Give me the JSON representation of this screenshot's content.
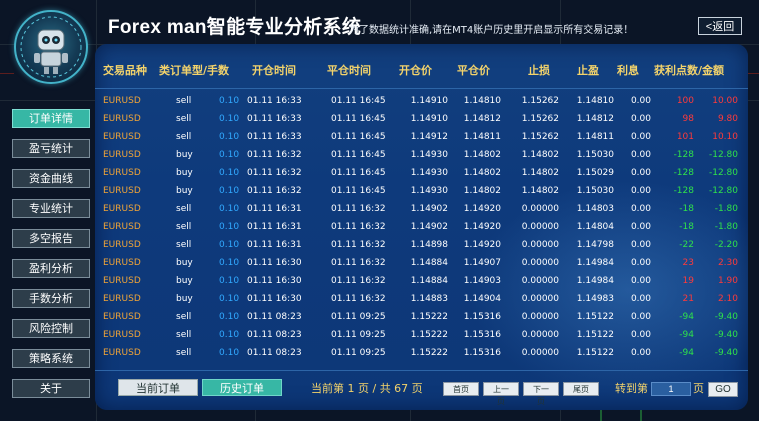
{
  "header": {
    "title": "Forex man智能专业分析系统",
    "subtitle": "为了数据统计准确,请在MT4账户历史里开启显示所有交易记录！",
    "back_label": "<返回"
  },
  "sidebar": {
    "items": [
      {
        "label": "订单详情",
        "active": true
      },
      {
        "label": "盈亏统计",
        "active": false
      },
      {
        "label": "资金曲线",
        "active": false
      },
      {
        "label": "专业统计",
        "active": false
      },
      {
        "label": "多空报告",
        "active": false
      },
      {
        "label": "盈利分析",
        "active": false
      },
      {
        "label": "手数分析",
        "active": false
      },
      {
        "label": "风险控制",
        "active": false
      },
      {
        "label": "策略系统",
        "active": false
      },
      {
        "label": "关于",
        "active": false
      }
    ]
  },
  "table": {
    "columns": [
      "交易品种",
      "类订单型/手数",
      "开仓时间",
      "平仓时间",
      "开仓价",
      "平仓价",
      "止损",
      "止盈",
      "利息",
      "获利点数/金额"
    ],
    "rows": [
      {
        "symbol": "EURUSD",
        "type": "sell",
        "lots": "0.10",
        "open_time": "01.11 16:33",
        "close_time": "01.11 16:45",
        "open_price": "1.14910",
        "close_price": "1.14810",
        "sl": "1.15262",
        "tp": "1.14810",
        "swap": "0.00",
        "points": "100",
        "amount": "10.00",
        "positive": true
      },
      {
        "symbol": "EURUSD",
        "type": "sell",
        "lots": "0.10",
        "open_time": "01.11 16:33",
        "close_time": "01.11 16:45",
        "open_price": "1.14910",
        "close_price": "1.14812",
        "sl": "1.15262",
        "tp": "1.14812",
        "swap": "0.00",
        "points": "98",
        "amount": "9.80",
        "positive": true
      },
      {
        "symbol": "EURUSD",
        "type": "sell",
        "lots": "0.10",
        "open_time": "01.11 16:33",
        "close_time": "01.11 16:45",
        "open_price": "1.14912",
        "close_price": "1.14811",
        "sl": "1.15262",
        "tp": "1.14811",
        "swap": "0.00",
        "points": "101",
        "amount": "10.10",
        "positive": true
      },
      {
        "symbol": "EURUSD",
        "type": "buy",
        "lots": "0.10",
        "open_time": "01.11 16:32",
        "close_time": "01.11 16:45",
        "open_price": "1.14930",
        "close_price": "1.14802",
        "sl": "1.14802",
        "tp": "1.15030",
        "swap": "0.00",
        "points": "-128",
        "amount": "-12.80",
        "positive": false
      },
      {
        "symbol": "EURUSD",
        "type": "buy",
        "lots": "0.10",
        "open_time": "01.11 16:32",
        "close_time": "01.11 16:45",
        "open_price": "1.14930",
        "close_price": "1.14802",
        "sl": "1.14802",
        "tp": "1.15029",
        "swap": "0.00",
        "points": "-128",
        "amount": "-12.80",
        "positive": false
      },
      {
        "symbol": "EURUSD",
        "type": "buy",
        "lots": "0.10",
        "open_time": "01.11 16:32",
        "close_time": "01.11 16:45",
        "open_price": "1.14930",
        "close_price": "1.14802",
        "sl": "1.14802",
        "tp": "1.15030",
        "swap": "0.00",
        "points": "-128",
        "amount": "-12.80",
        "positive": false
      },
      {
        "symbol": "EURUSD",
        "type": "sell",
        "lots": "0.10",
        "open_time": "01.11 16:31",
        "close_time": "01.11 16:32",
        "open_price": "1.14902",
        "close_price": "1.14920",
        "sl": "0.00000",
        "tp": "1.14803",
        "swap": "0.00",
        "points": "-18",
        "amount": "-1.80",
        "positive": false
      },
      {
        "symbol": "EURUSD",
        "type": "sell",
        "lots": "0.10",
        "open_time": "01.11 16:31",
        "close_time": "01.11 16:32",
        "open_price": "1.14902",
        "close_price": "1.14920",
        "sl": "0.00000",
        "tp": "1.14804",
        "swap": "0.00",
        "points": "-18",
        "amount": "-1.80",
        "positive": false
      },
      {
        "symbol": "EURUSD",
        "type": "sell",
        "lots": "0.10",
        "open_time": "01.11 16:31",
        "close_time": "01.11 16:32",
        "open_price": "1.14898",
        "close_price": "1.14920",
        "sl": "0.00000",
        "tp": "1.14798",
        "swap": "0.00",
        "points": "-22",
        "amount": "-2.20",
        "positive": false
      },
      {
        "symbol": "EURUSD",
        "type": "buy",
        "lots": "0.10",
        "open_time": "01.11 16:30",
        "close_time": "01.11 16:32",
        "open_price": "1.14884",
        "close_price": "1.14907",
        "sl": "0.00000",
        "tp": "1.14984",
        "swap": "0.00",
        "points": "23",
        "amount": "2.30",
        "positive": true
      },
      {
        "symbol": "EURUSD",
        "type": "buy",
        "lots": "0.10",
        "open_time": "01.11 16:30",
        "close_time": "01.11 16:32",
        "open_price": "1.14884",
        "close_price": "1.14903",
        "sl": "0.00000",
        "tp": "1.14984",
        "swap": "0.00",
        "points": "19",
        "amount": "1.90",
        "positive": true
      },
      {
        "symbol": "EURUSD",
        "type": "buy",
        "lots": "0.10",
        "open_time": "01.11 16:30",
        "close_time": "01.11 16:32",
        "open_price": "1.14883",
        "close_price": "1.14904",
        "sl": "0.00000",
        "tp": "1.14983",
        "swap": "0.00",
        "points": "21",
        "amount": "2.10",
        "positive": true
      },
      {
        "symbol": "EURUSD",
        "type": "sell",
        "lots": "0.10",
        "open_time": "01.11 08:23",
        "close_time": "01.11 09:25",
        "open_price": "1.15222",
        "close_price": "1.15316",
        "sl": "0.00000",
        "tp": "1.15122",
        "swap": "0.00",
        "points": "-94",
        "amount": "-9.40",
        "positive": false
      },
      {
        "symbol": "EURUSD",
        "type": "sell",
        "lots": "0.10",
        "open_time": "01.11 08:23",
        "close_time": "01.11 09:25",
        "open_price": "1.15222",
        "close_price": "1.15316",
        "sl": "0.00000",
        "tp": "1.15122",
        "swap": "0.00",
        "points": "-94",
        "amount": "-9.40",
        "positive": false
      },
      {
        "symbol": "EURUSD",
        "type": "sell",
        "lots": "0.10",
        "open_time": "01.11 08:23",
        "close_time": "01.11 09:25",
        "open_price": "1.15222",
        "close_price": "1.15316",
        "sl": "0.00000",
        "tp": "1.15122",
        "swap": "0.00",
        "points": "-94",
        "amount": "-9.40",
        "positive": false
      }
    ]
  },
  "footer": {
    "current_orders_label": "当前订单",
    "history_orders_label": "历史订单",
    "page_info": "当前第 1 页 / 共 67 页",
    "first_label": "首页",
    "prev_label": "上一页",
    "next_label": "下一页",
    "last_label": "尾页",
    "goto_label": "转到第",
    "goto_value": "1",
    "page_suffix": "页",
    "go_label": "GO"
  },
  "colors": {
    "panel": "#0e3a7c",
    "header_text": "#f3d36b",
    "symbol_text": "#f0a437",
    "lots_text": "#31a9ff",
    "profit": "#ff3a3a",
    "loss": "#2fe14a",
    "active_tab": "#37b7a5"
  }
}
